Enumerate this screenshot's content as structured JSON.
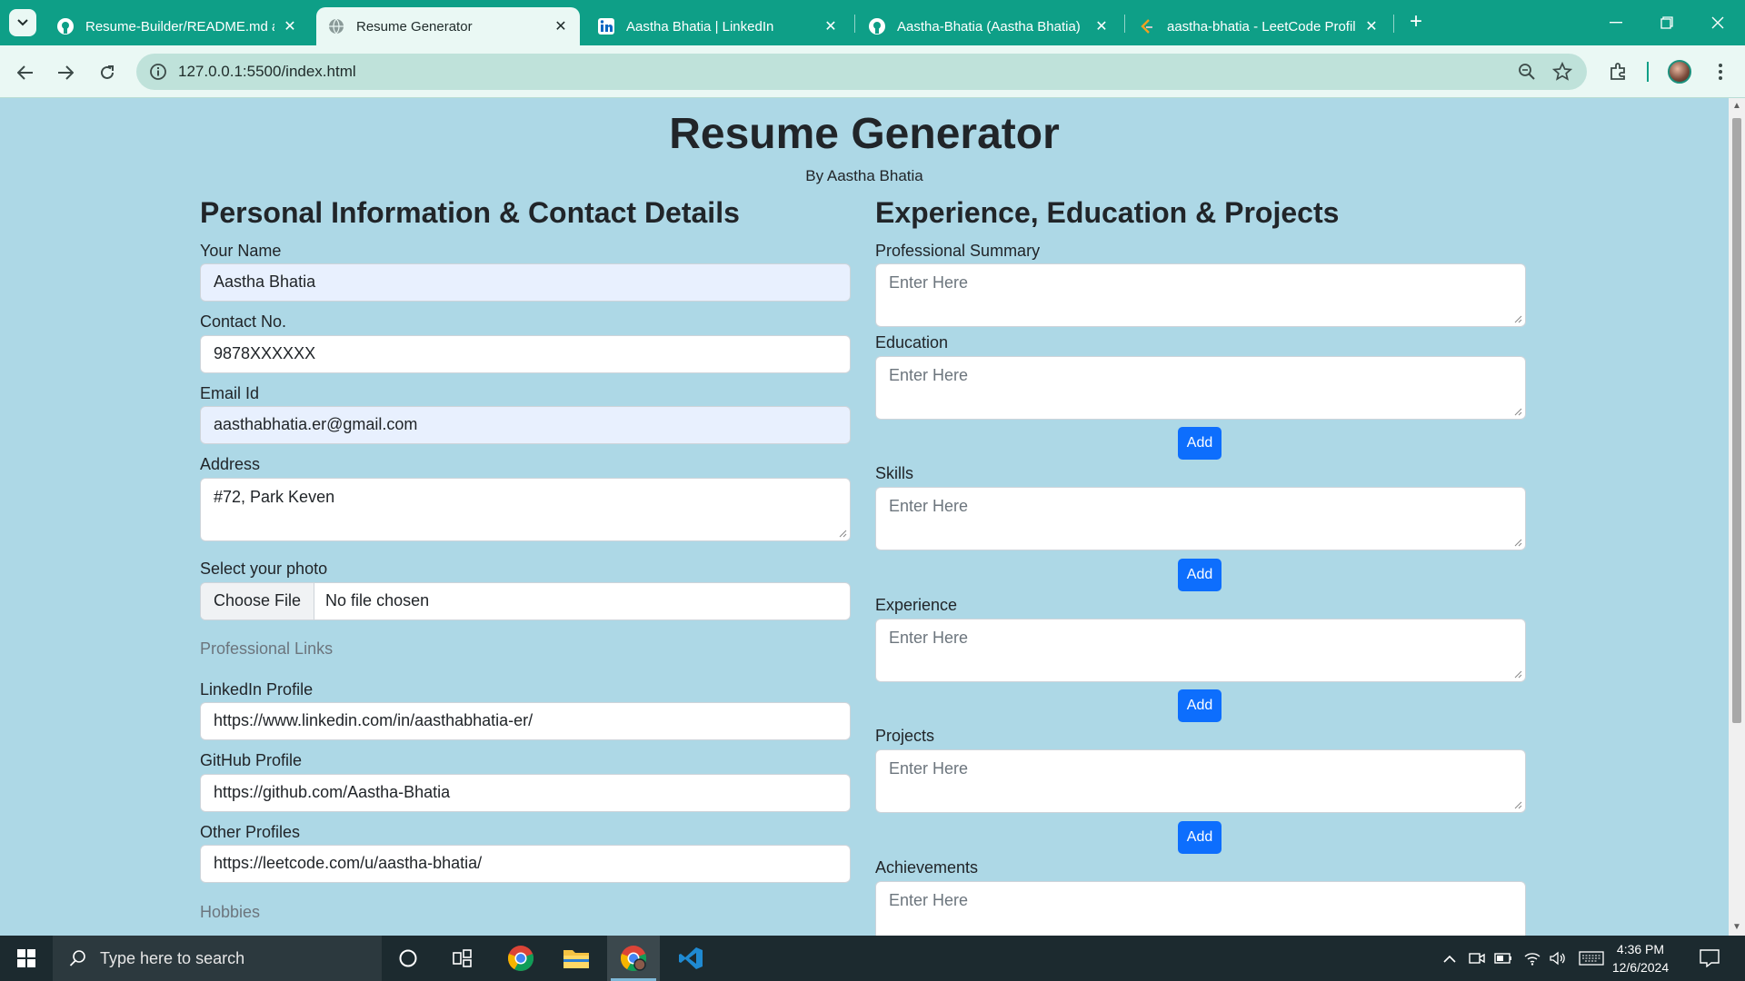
{
  "browser": {
    "tabs": [
      {
        "title": "Resume-Builder/README.md at",
        "icon": "github-icon",
        "close": "✕"
      },
      {
        "title": "Resume Generator",
        "icon": "globe-icon",
        "close": "✕"
      },
      {
        "title": "Aastha Bhatia | LinkedIn",
        "icon": "linkedin-icon",
        "close": "✕"
      },
      {
        "title": "Aastha-Bhatia (Aastha Bhatia)",
        "icon": "github-icon",
        "close": "✕"
      },
      {
        "title": "aastha-bhatia - LeetCode Profile",
        "icon": "leetcode-icon",
        "close": "✕"
      }
    ],
    "new_tab": "+",
    "url": "127.0.0.1:5500/index.html",
    "accent": "#0e9f87"
  },
  "page": {
    "title": "Resume Generator",
    "subtitle": "By Aastha Bhatia",
    "left": {
      "heading": "Personal Information & Contact Details",
      "name_label": "Your Name",
      "name_value": "Aastha Bhatia",
      "contact_label": "Contact No.",
      "contact_value": "9878XXXXXX",
      "email_label": "Email Id",
      "email_value": "aasthabhatia.er@gmail.com",
      "address_label": "Address",
      "address_value": "#72, Park Keven",
      "photo_label": "Select your photo",
      "photo_button": "Choose File",
      "photo_status": "No file chosen",
      "links_heading": "Professional Links",
      "linkedin_label": "LinkedIn Profile",
      "linkedin_value": "https://www.linkedin.com/in/aasthabhatia-er/",
      "github_label": "GitHub Profile",
      "github_value": "https://github.com/Aastha-Bhatia",
      "other_label": "Other Profiles",
      "other_value": "https://leetcode.com/u/aastha-bhatia/",
      "hobbies_heading": "Hobbies"
    },
    "right": {
      "heading": "Experience, Education & Projects",
      "summary_label": "Professional Summary",
      "education_label": "Education",
      "skills_label": "Skills",
      "experience_label": "Experience",
      "projects_label": "Projects",
      "achievements_label": "Achievements",
      "placeholder": "Enter Here",
      "add_label": "Add"
    }
  },
  "taskbar": {
    "search_placeholder": "Type here to search",
    "time": "4:36 PM",
    "date": "12/6/2024"
  }
}
